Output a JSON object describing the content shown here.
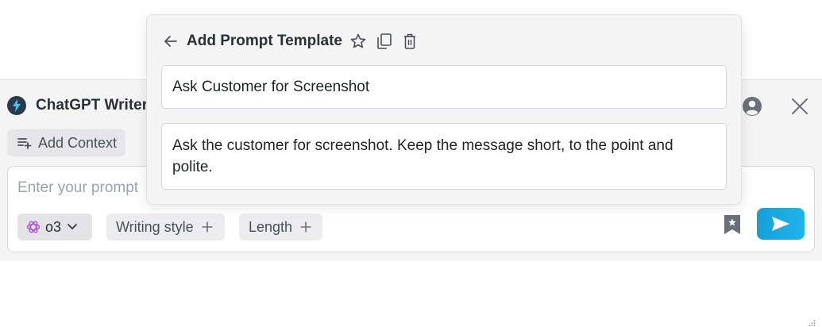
{
  "writer": {
    "brand_title": "ChatGPT Writer",
    "add_context_label": "Add Context",
    "prompt_placeholder": "Enter your prompt",
    "model_label": "o3",
    "writing_style_label": "Writing style",
    "length_label": "Length"
  },
  "template_editor": {
    "title": "Add Prompt Template",
    "template_name": "Ask Customer for Screenshot",
    "template_body": "Ask the customer for screenshot. Keep the message short, to the point and polite."
  },
  "icons": {
    "brand": "lightning-bolt-icon",
    "back": "arrow-left-icon",
    "favorite": "star-icon",
    "duplicate": "copy-icon",
    "delete": "trash-icon",
    "account": "user-circle-icon",
    "close": "close-icon",
    "add_context": "list-add-icon",
    "model": "openai-logo-icon",
    "dropdown": "chevron-down-icon",
    "add": "plus-icon",
    "bookmark": "bookmark-star-icon",
    "send": "send-icon"
  },
  "colors": {
    "send_button": "#14a0d9",
    "model_logo": "#b25ad8",
    "brand_logo_bg": "#2a3a4d",
    "brand_bolt": "#3ec6f0"
  }
}
